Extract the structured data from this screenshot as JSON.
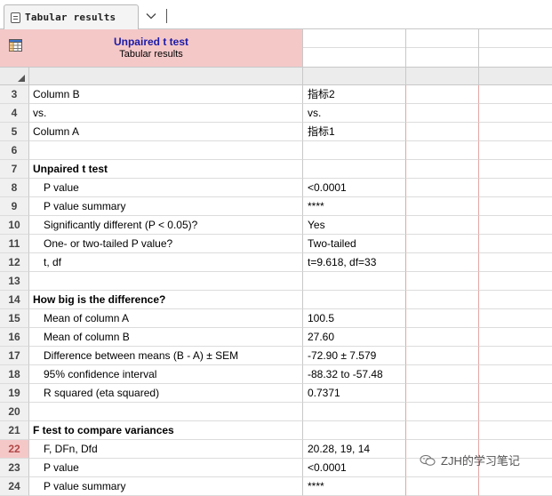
{
  "tab": {
    "label": "Tabular results"
  },
  "sheet": {
    "title": "Unpaired t test",
    "subtitle": "Tabular results"
  },
  "rows": [
    {
      "num": "3",
      "label": "Column B",
      "value": "指标2",
      "style": "plain"
    },
    {
      "num": "4",
      "label": "vs.",
      "value": "vs.",
      "style": "plain"
    },
    {
      "num": "5",
      "label": "Column A",
      "value": "指标1",
      "style": "plain"
    },
    {
      "num": "6",
      "label": "",
      "value": "",
      "style": "plain"
    },
    {
      "num": "7",
      "label": "Unpaired t test",
      "value": "",
      "style": "heading"
    },
    {
      "num": "8",
      "label": "P value",
      "value": "<0.0001",
      "style": "indent"
    },
    {
      "num": "9",
      "label": "P value summary",
      "value": "****",
      "style": "indent"
    },
    {
      "num": "10",
      "label": "Significantly different (P < 0.05)?",
      "value": "Yes",
      "style": "indent"
    },
    {
      "num": "11",
      "label": "One- or two-tailed P value?",
      "value": "Two-tailed",
      "style": "indent"
    },
    {
      "num": "12",
      "label": "t, df",
      "value": "t=9.618, df=33",
      "style": "indent"
    },
    {
      "num": "13",
      "label": "",
      "value": "",
      "style": "plain"
    },
    {
      "num": "14",
      "label": "How big is the difference?",
      "value": "",
      "style": "heading"
    },
    {
      "num": "15",
      "label": "Mean of column A",
      "value": "100.5",
      "style": "indent"
    },
    {
      "num": "16",
      "label": "Mean of column B",
      "value": "27.60",
      "style": "indent"
    },
    {
      "num": "17",
      "label": "Difference between means (B - A) ± SEM",
      "value": "-72.90 ± 7.579",
      "style": "indent"
    },
    {
      "num": "18",
      "label": "95% confidence interval",
      "value": "-88.32 to -57.48",
      "style": "indent"
    },
    {
      "num": "19",
      "label": "R squared (eta squared)",
      "value": "0.7371",
      "style": "indent"
    },
    {
      "num": "20",
      "label": "",
      "value": "",
      "style": "plain"
    },
    {
      "num": "21",
      "label": "F test to compare variances",
      "value": "",
      "style": "heading"
    },
    {
      "num": "22",
      "label": "F, DFn, Dfd",
      "value": "20.28, 19, 14",
      "style": "indent",
      "selected": true
    },
    {
      "num": "23",
      "label": "P value",
      "value": "<0.0001",
      "style": "indent"
    },
    {
      "num": "24",
      "label": "P value summary",
      "value": "****",
      "style": "indent"
    }
  ],
  "watermark": {
    "text": "ZJH的学习笔记"
  },
  "colors": {
    "header_bg": "#f5c8c8",
    "title_color": "#1a1aa8",
    "selected_row": "#f5c8c8"
  }
}
